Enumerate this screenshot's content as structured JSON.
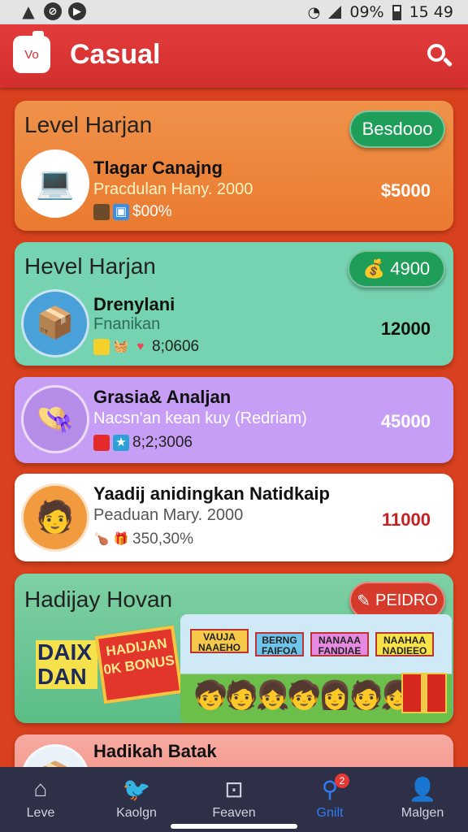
{
  "status_bar": {
    "battery": "09%",
    "time": "15 49"
  },
  "app": {
    "title": "Casual",
    "logo_text": "Vo"
  },
  "cards": [
    {
      "heading": "Level Harjan",
      "pill_label": "Besdooo",
      "title": "Tlagar Canajng",
      "subtitle": "Pracdulan Hany. 2000",
      "stat": "$00%",
      "price": "$5000"
    },
    {
      "heading": "Hevel Harjan",
      "pill_label": "4900",
      "title": "Drenylani",
      "subtitle": "Fnanikan",
      "stat": "8;0606",
      "price": "12000"
    },
    {
      "title": "Grasia& Analjan",
      "subtitle": "Nacsn'an kean kuy (Redriam)",
      "stat": "8;2;3006",
      "price": "45000"
    },
    {
      "title": "Yaadij anidingkan Natidkaip",
      "subtitle": "Peaduan Mary. 2000",
      "stat": "350,30%",
      "price": "11000"
    },
    {
      "heading": "Hadijay Hovan",
      "pill_label": "PEIDRO",
      "promo_left": "DAIX DAN",
      "bonus_sign": "HADIJAN 0K BONUS",
      "banners": [
        "VAUJA NAAEHO",
        "BERNG FAIFOA",
        "NANAAA FANDIAE",
        "NAAHAA NADIEEO"
      ]
    },
    {
      "title": "Hadikah Batak"
    }
  ],
  "nav": [
    {
      "label": "Leve",
      "icon": "home-icon"
    },
    {
      "label": "Kaolgn",
      "icon": "bird-icon"
    },
    {
      "label": "Feaven",
      "icon": "square-icon"
    },
    {
      "label": "Gnilt",
      "icon": "search-icon",
      "badge": "2"
    },
    {
      "label": "Malgen",
      "icon": "person-icon"
    }
  ],
  "colors": {
    "appbar": "#d32f2f",
    "background": "#d9411e",
    "active_tab": "#2e7cf6",
    "green_pill": "#1f9e5a",
    "red_pill": "#d63a2a"
  }
}
